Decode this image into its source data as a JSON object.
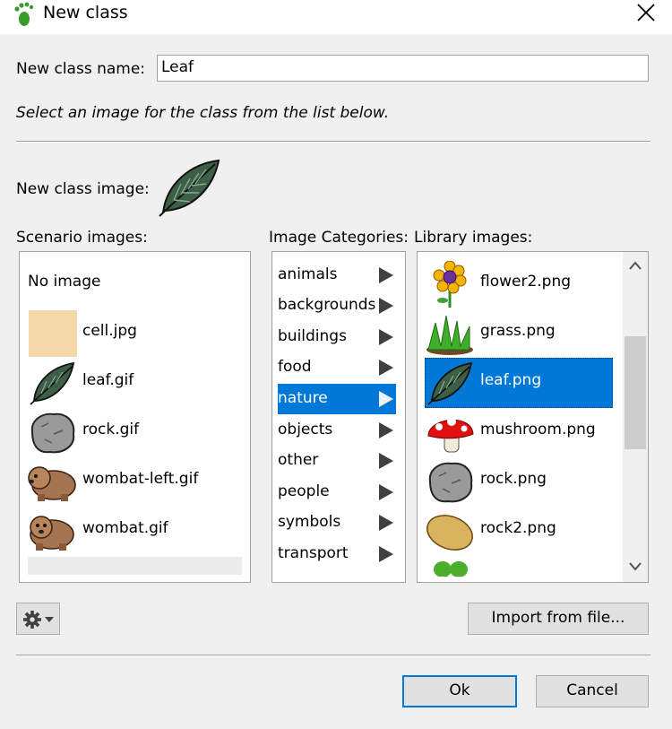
{
  "window": {
    "title": "New class"
  },
  "form": {
    "name_label": "New class name:",
    "name_value": "Leaf",
    "instruction": "Select an image for the class from the list below.",
    "image_label": "New class image:"
  },
  "scenario": {
    "header": "Scenario images:",
    "none_label": "No image",
    "items": [
      {
        "label": "cell.jpg",
        "icon": "cell-texture-icon"
      },
      {
        "label": "leaf.gif",
        "icon": "leaf-icon"
      },
      {
        "label": "rock.gif",
        "icon": "rock-icon"
      },
      {
        "label": "wombat-left.gif",
        "icon": "wombat-icon"
      },
      {
        "label": "wombat.gif",
        "icon": "wombat-icon"
      }
    ]
  },
  "categories": {
    "header": "Image Categories:",
    "selected": "nature",
    "items": [
      "animals",
      "backgrounds",
      "buildings",
      "food",
      "nature",
      "objects",
      "other",
      "people",
      "symbols",
      "transport"
    ]
  },
  "library": {
    "header": "Library images:",
    "selected": "leaf.png",
    "items": [
      {
        "label": "flower2.png",
        "icon": "flower-icon"
      },
      {
        "label": "grass.png",
        "icon": "grass-icon"
      },
      {
        "label": "leaf.png",
        "icon": "leaf-icon"
      },
      {
        "label": "mushroom.png",
        "icon": "mushroom-icon"
      },
      {
        "label": "rock.png",
        "icon": "rock-icon"
      },
      {
        "label": "rock2.png",
        "icon": "potato-rock-icon"
      }
    ]
  },
  "buttons": {
    "import_label": "Import from file...",
    "ok_label": "Ok",
    "cancel_label": "Cancel"
  },
  "colors": {
    "selection": "#0078d7",
    "dialog_bg": "#f0f0f0"
  }
}
